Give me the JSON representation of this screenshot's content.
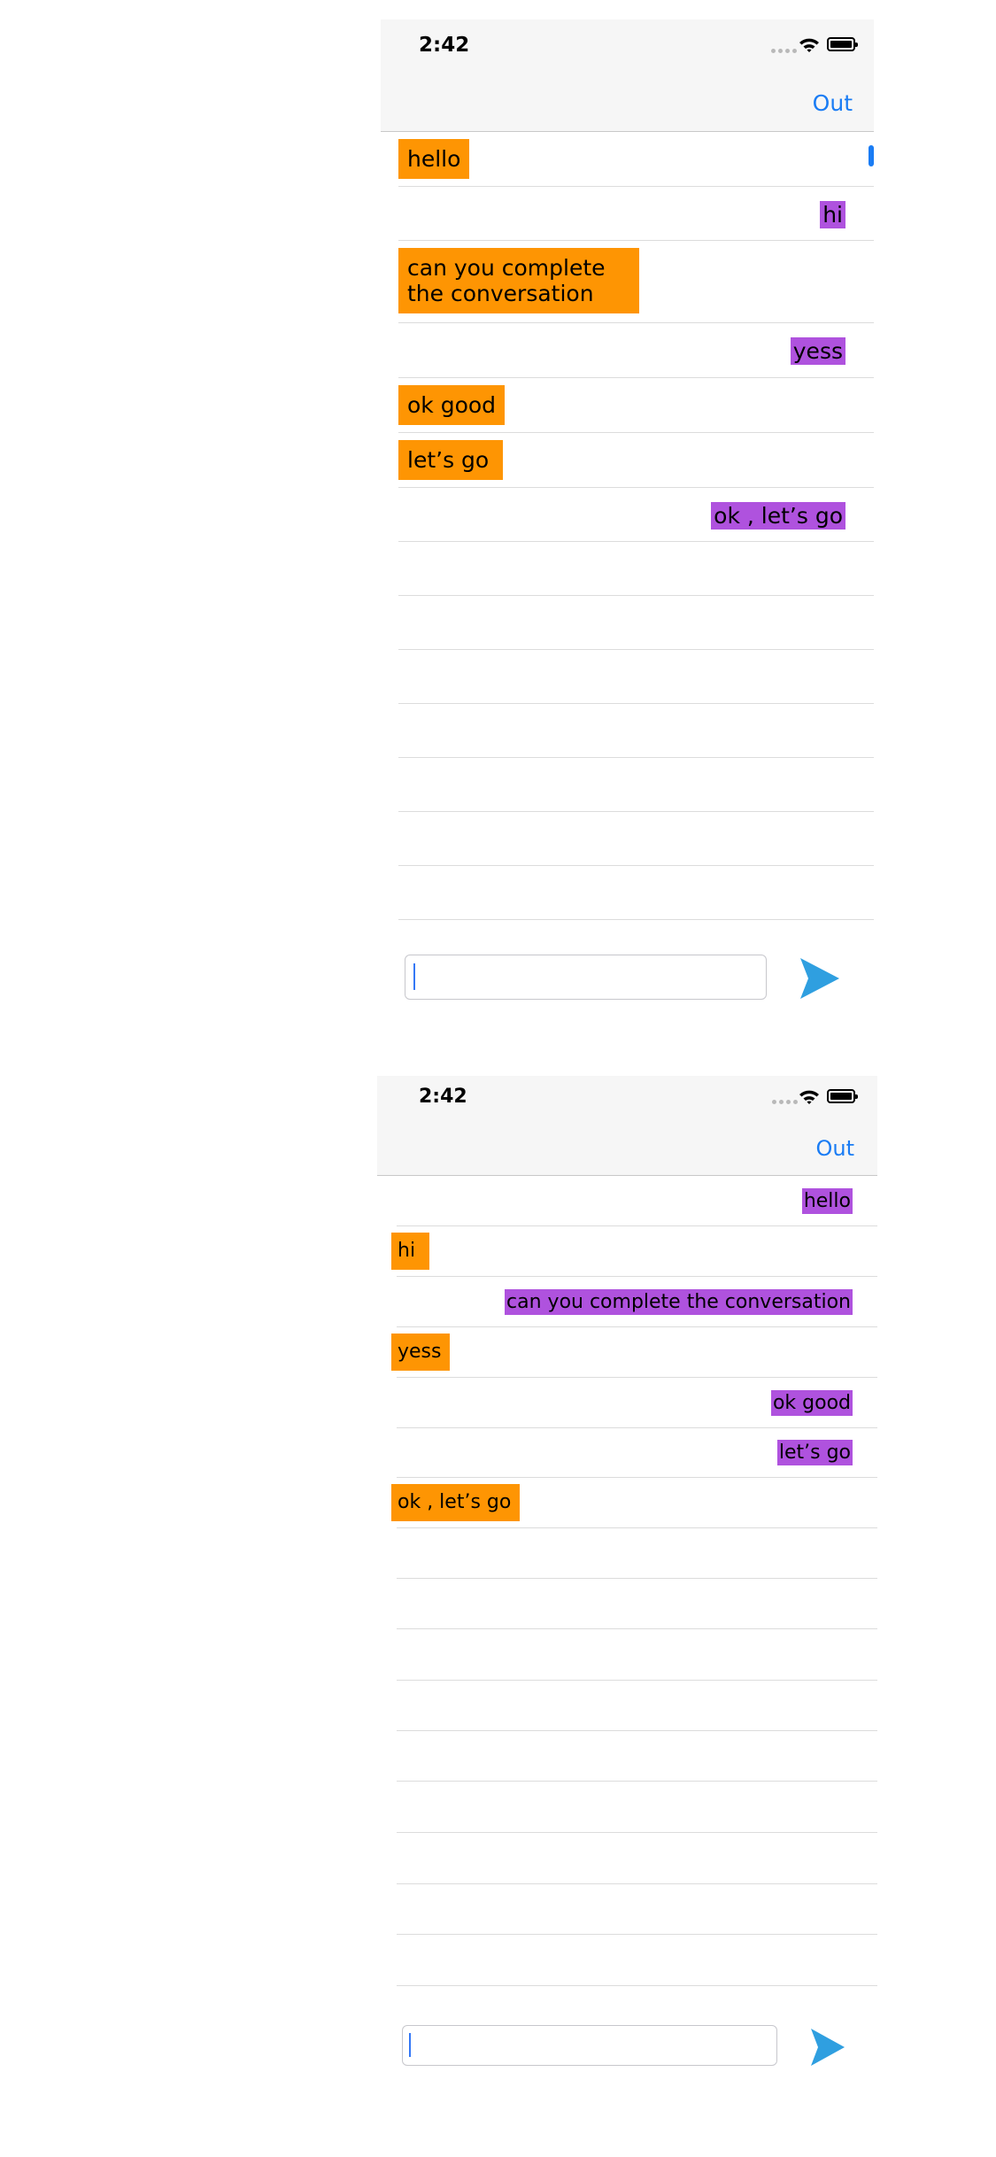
{
  "colors": {
    "header_bg": "#f6f6f6",
    "link_blue": "#1a7cf4",
    "bubble_orange": "#fe9503",
    "bubble_purple": "#af52de",
    "send_blue": "#2f9fe0",
    "separator": "#dcdcdc"
  },
  "icons": {
    "signal": "signal-dots-icon",
    "wifi": "wifi-icon",
    "battery": "battery-icon",
    "send": "paper-plane-send-icon"
  },
  "screens": [
    {
      "status": {
        "time": "2:42"
      },
      "nav": {
        "out_label": "Out"
      },
      "messages": [
        {
          "text": "hello",
          "side": "left",
          "color": "orange"
        },
        {
          "text": "hi",
          "side": "right",
          "color": "purple"
        },
        {
          "text": "can you complete the conversation",
          "side": "left",
          "color": "orange"
        },
        {
          "text": "yess",
          "side": "right",
          "color": "purple"
        },
        {
          "text": "ok good",
          "side": "left",
          "color": "orange"
        },
        {
          "text": "let’s go",
          "side": "left",
          "color": "orange"
        },
        {
          "text": "ok , let’s go",
          "side": "right",
          "color": "purple"
        }
      ],
      "input": {
        "value": "",
        "placeholder": ""
      }
    },
    {
      "status": {
        "time": "2:42"
      },
      "nav": {
        "out_label": "Out"
      },
      "messages": [
        {
          "text": "hello",
          "side": "right",
          "color": "purple"
        },
        {
          "text": "hi",
          "side": "left",
          "color": "orange"
        },
        {
          "text": "can you complete the conversation",
          "side": "right",
          "color": "purple"
        },
        {
          "text": "yess",
          "side": "left",
          "color": "orange"
        },
        {
          "text": "ok good",
          "side": "right",
          "color": "purple"
        },
        {
          "text": "let’s go",
          "side": "right",
          "color": "purple"
        },
        {
          "text": "ok , let’s go",
          "side": "left",
          "color": "orange"
        }
      ],
      "input": {
        "value": "",
        "placeholder": ""
      }
    }
  ]
}
